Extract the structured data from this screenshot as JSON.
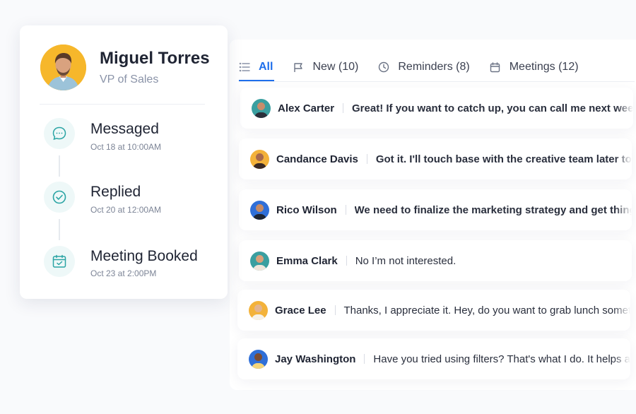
{
  "contact": {
    "name": "Miguel Torres",
    "title": "VP of Sales",
    "steps": [
      {
        "label": "Messaged",
        "date": "Oct 18 at 10:00AM",
        "icon": "chat-bubble-icon"
      },
      {
        "label": "Replied",
        "date": "Oct 20 at 12:00AM",
        "icon": "check-circle-icon"
      },
      {
        "label": "Meeting Booked",
        "date": "Oct 23 at 2:00PM",
        "icon": "calendar-check-icon"
      }
    ]
  },
  "tabs": [
    {
      "label": "All",
      "icon": "list-icon",
      "active": true
    },
    {
      "label": "New (10)",
      "icon": "flag-icon",
      "active": false
    },
    {
      "label": "Reminders (8)",
      "icon": "clock-icon",
      "active": false
    },
    {
      "label": "Meetings (12)",
      "icon": "calendar-icon",
      "active": false
    }
  ],
  "messages": [
    {
      "name": "Alex Carter",
      "text": "Great! If you want to catch up, you can call me next week.",
      "bold": true,
      "avatar_bg": "#3a9fa0"
    },
    {
      "name": "Candance Davis",
      "text": "Got it. I'll touch base with the creative team later today.",
      "bold": true,
      "avatar_bg": "#f3b23a"
    },
    {
      "name": "Rico Wilson",
      "text": "We need to finalize the marketing strategy and get things moving.",
      "bold": true,
      "avatar_bg": "#2f6fd8"
    },
    {
      "name": "Emma Clark",
      "text": "No I’m not interested.",
      "bold": false,
      "avatar_bg": "#3a9fa0"
    },
    {
      "name": "Grace Lee",
      "text": "Thanks, I appreciate it. Hey, do you want to grab lunch sometime?",
      "bold": false,
      "avatar_bg": "#f3b23a"
    },
    {
      "name": "Jay Washington",
      "text": "Have you tried using filters? That's what I do. It helps a lot.",
      "bold": false,
      "avatar_bg": "#2f6fd8"
    }
  ],
  "colors": {
    "accent": "#1f6feb",
    "avatar_yellow": "#f6b72b",
    "step_icon_bg": "#eef8f8",
    "step_icon_stroke": "#2aa4a4"
  }
}
